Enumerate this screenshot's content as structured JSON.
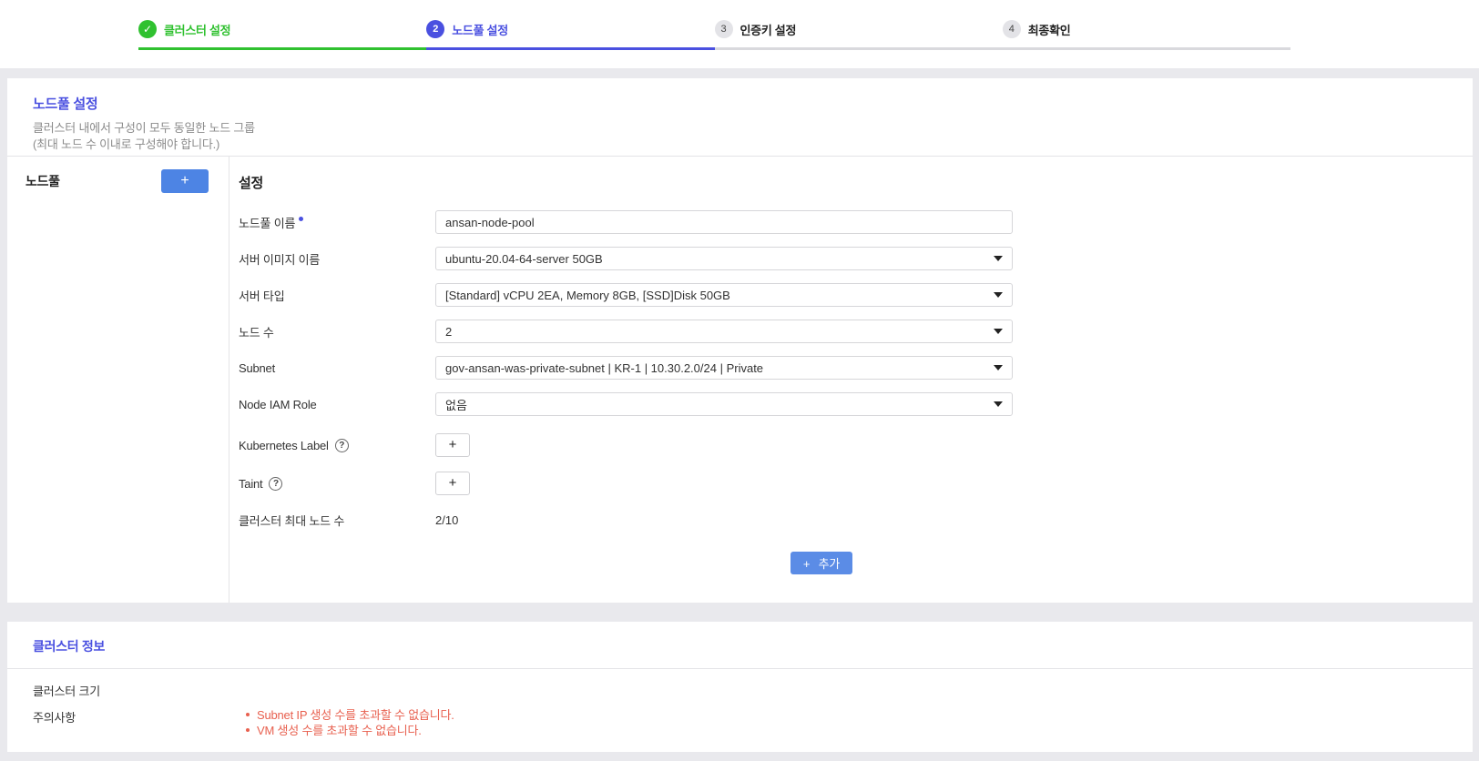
{
  "colors": {
    "step_done_green": "#30c130",
    "step_active_indigo": "#4a50e0",
    "section_title_indigo": "#4a50e0",
    "caution_red": "#e8604f",
    "primary_button_blue": "#4d84e4",
    "submit_button_blue": "#5b8ce6"
  },
  "icons": {
    "check": "✓",
    "plus": "+",
    "help": "?"
  },
  "wizard": {
    "steps": [
      {
        "number": "1",
        "label": "클러스터 설정",
        "state": "done"
      },
      {
        "number": "2",
        "label": "노드풀 설정",
        "state": "active"
      },
      {
        "number": "3",
        "label": "인증키 설정",
        "state": "pending"
      },
      {
        "number": "4",
        "label": "최종확인",
        "state": "pending"
      }
    ]
  },
  "nodepool_section": {
    "title": "노드풀 설정",
    "description_line1": "클러스터 내에서 구성이 모두 동일한 노드 그룹",
    "description_line2": "(최대 노드 수 이내로 구성해야 합니다.)",
    "sidebar": {
      "title": "노드풀"
    },
    "settings": {
      "title": "설정",
      "fields": [
        {
          "label": "노드풀 이름",
          "type": "text",
          "required": true,
          "value": "ansan-node-pool"
        },
        {
          "label": "서버 이미지 이름",
          "type": "select",
          "value": "ubuntu-20.04-64-server 50GB"
        },
        {
          "label": "서버 타입",
          "type": "select",
          "value": "[Standard] vCPU 2EA, Memory 8GB, [SSD]Disk 50GB"
        },
        {
          "label": "노드 수",
          "type": "select",
          "value": "2"
        },
        {
          "label": "Subnet",
          "type": "select",
          "value": "gov-ansan-was-private-subnet | KR-1 | 10.30.2.0/24 | Private"
        },
        {
          "label": "Node IAM Role",
          "type": "select",
          "value": "없음"
        },
        {
          "label": "Kubernetes Label",
          "type": "add",
          "help": true
        },
        {
          "label": "Taint",
          "type": "add",
          "help": true
        },
        {
          "label": "클러스터 최대 노드 수",
          "type": "static",
          "value": "2/10"
        }
      ],
      "submit_button_label": "추가"
    }
  },
  "cluster_info_section": {
    "title": "클러스터 정보",
    "size_label": "클러스터 크기",
    "size_value": "",
    "caution_label": "주의사항",
    "cautions": [
      "Subnet IP 생성 수를 초과할 수 없습니다.",
      "VM 생성 수를 초과할 수 없습니다."
    ]
  }
}
